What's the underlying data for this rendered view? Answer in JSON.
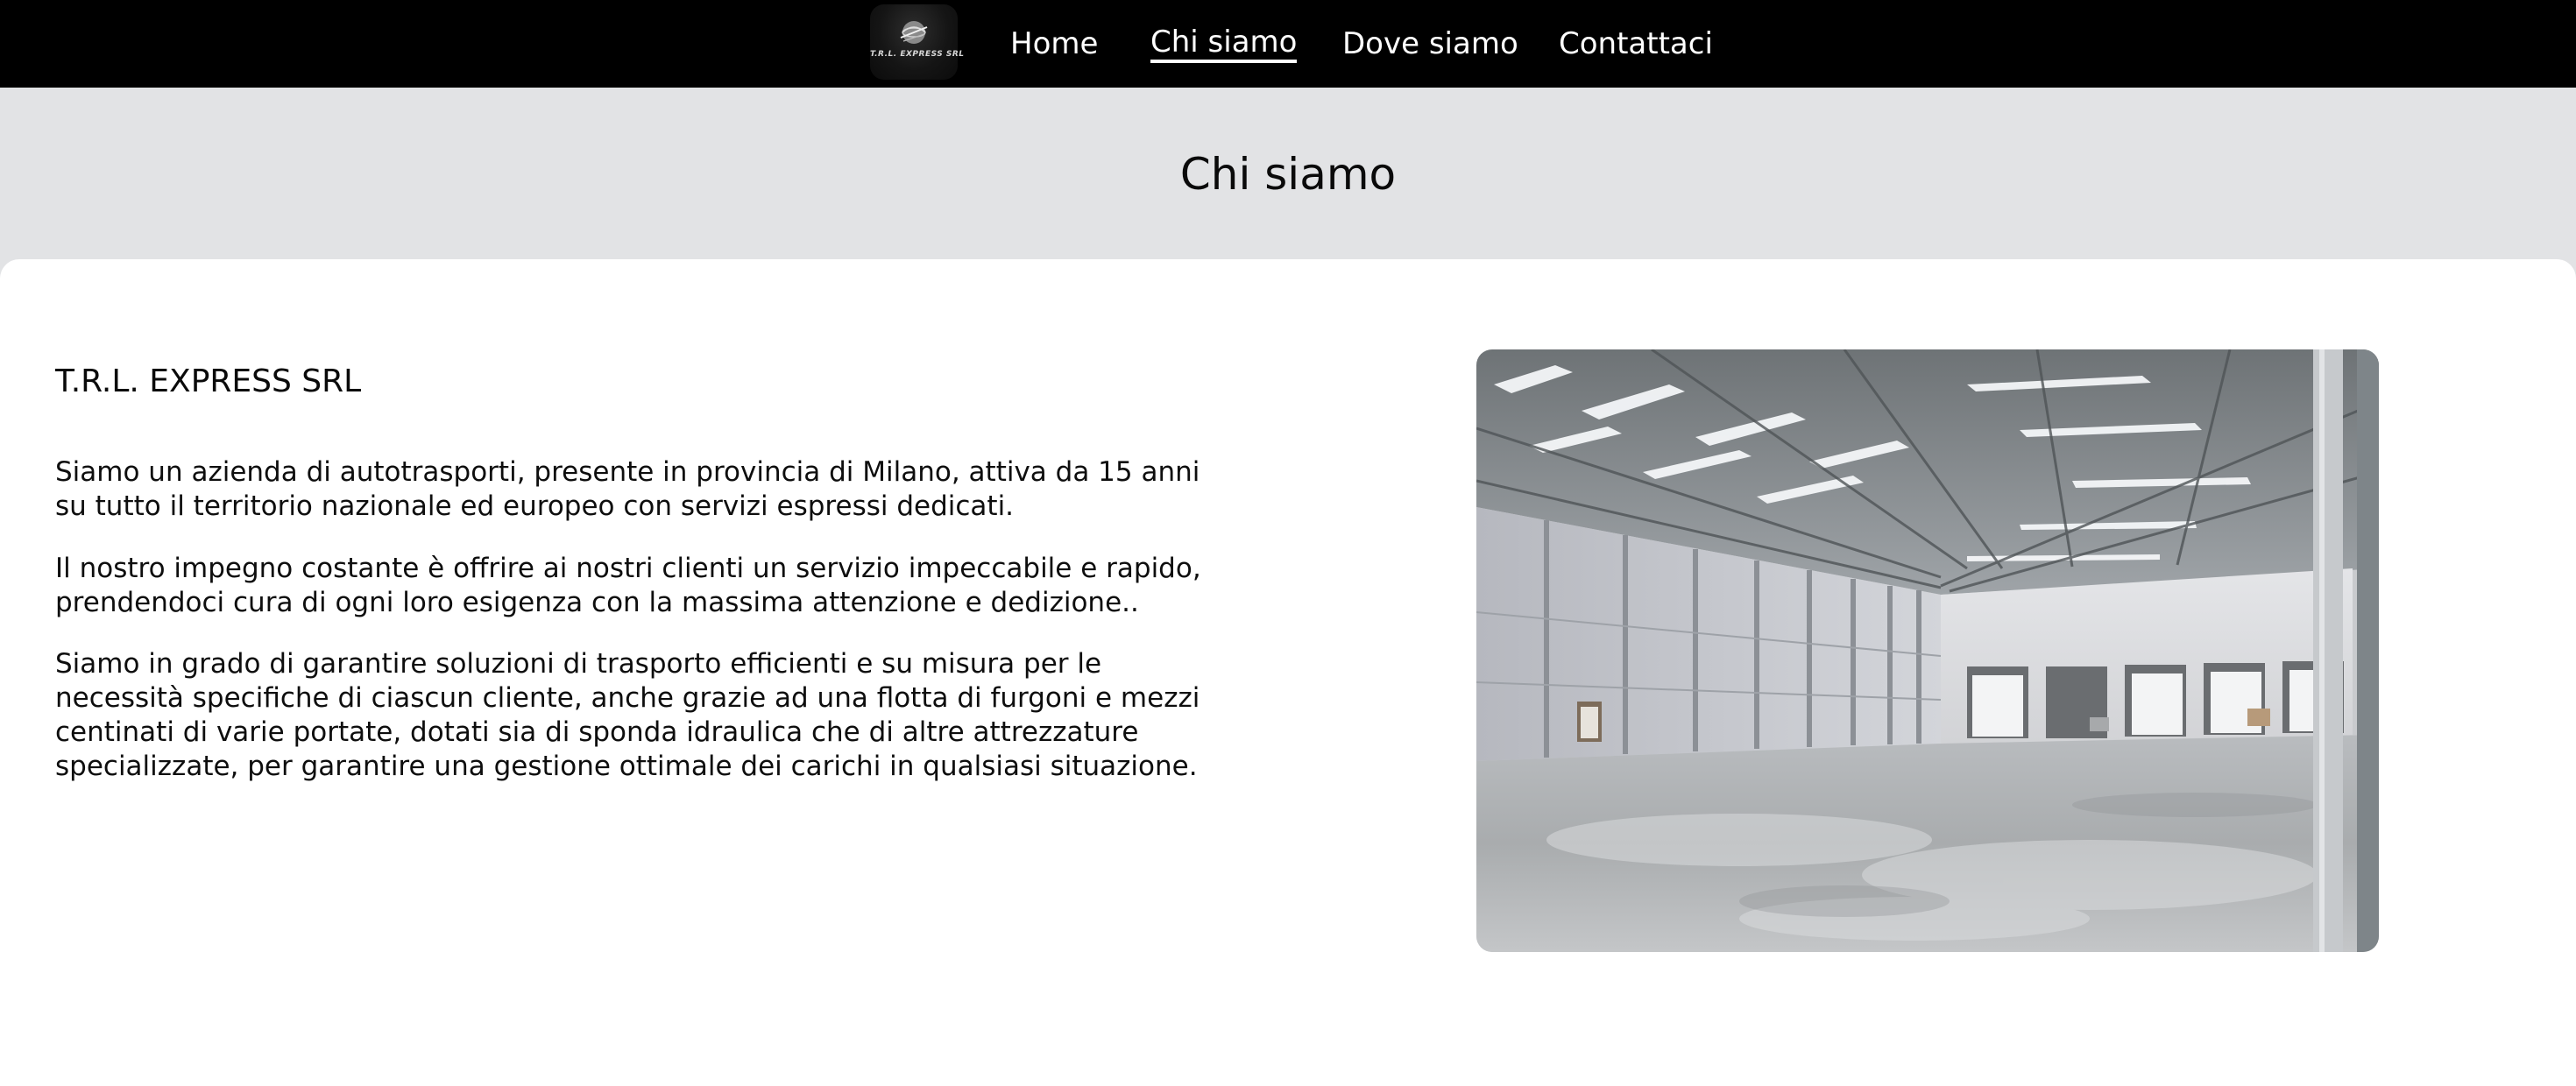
{
  "header": {
    "logo_text": "T.R.L. EXPRESS SRL",
    "nav": [
      {
        "label": "Home",
        "active": false
      },
      {
        "label": "Chi siamo",
        "active": true
      },
      {
        "label": "Dove siamo",
        "active": false
      },
      {
        "label": "Contattaci",
        "active": false
      }
    ]
  },
  "page": {
    "title": "Chi siamo"
  },
  "content": {
    "company_name": "T.R.L. EXPRESS SRL",
    "paragraphs": [
      [
        "Siamo un azienda di autotrasporti, presente in provincia di Milano, attiva da 15 anni",
        "su tutto il territorio nazionale ed europeo con servizi espressi dedicati."
      ],
      [
        "Il nostro impegno costante è offrire ai nostri clienti un servizio impeccabile e rapido,",
        "prendendoci cura di ogni loro esigenza con la massima attenzione e dedizione.."
      ],
      [
        "Siamo in grado di garantire soluzioni di trasporto efficienti e su misura per le",
        "necessità specifiche di ciascun cliente, anche grazie ad una flotta di furgoni e mezzi",
        "centinati di varie portate, dotati sia di sponda idraulica che di altre attrezzature",
        "specializzate, per garantire una gestione ottimale dei carichi in qualsiasi situazione."
      ]
    ]
  },
  "colors": {
    "topbar": "#000000",
    "band": "#e2e3e5",
    "card": "#ffffff",
    "nav_text": "#ffffff",
    "body_text": "#0e0e0e"
  }
}
